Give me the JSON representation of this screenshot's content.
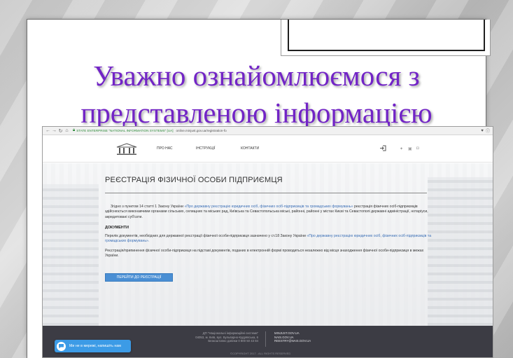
{
  "slide": {
    "title_line1": "Уважно ознайомлюємося з",
    "title_line2": "представленою інформацією"
  },
  "browser": {
    "secure_label": "STATE ENTERPRISE \"NATIONAL INFORMATION SYSTEMS\" [UA]",
    "url": "online.minjust.gov.ua/registration-fo"
  },
  "header": {
    "nav": [
      "ПРО НАС",
      "ІНСТРУКЦІЇ",
      "КОНТАКТИ"
    ]
  },
  "main": {
    "heading": "РЕЄСТРАЦІЯ ФІЗИЧНОЇ ОСОБИ ПІДПРИЄМЦЯ",
    "para1_text_a": "Згідно з пунктом 14 статті 1 Закону України ",
    "para1_link": "«Про державну реєстрацію юридичних осіб, фізичних осіб-підприємців та громадських формувань»",
    "para1_text_b": " реєстрація фізичних осіб-підприємців здійснюється виконавчими органами сільських, селищних та міських рад, Київська та Севастопольська міські, районні, районні у містах Києві та Севастополі державні адміністрації, нотаріуси, акредитовані суб'єкти.",
    "docs_heading": "ДОКУМЕНТИ",
    "para2_text_a": "Перелік документів, необхідних для державної реєстрації фізичної особи-підприємця зазначено у ст.18 Закону України ",
    "para2_link": "«Про державну реєстрацію юридичних осіб, фізичних осіб-підприємців та громадських формувань».",
    "para3": "Реєстрація/припинення фізичної особи-підприємця на підставі документів, поданих в електронній формі  проводиться незалежно від місця знаходження фізичної особи-підприємця в межах України.",
    "button": "ПЕРЕЙТИ ДО РЕЄСТРАЦІЇ"
  },
  "footer": {
    "address": [
      "ДП \"Національні інформаційні системи\"",
      "04053, м. Київ, вул. Бульварно-Кудрявська, 6",
      "Безкоштовно дзвінки 0 800 50 43 84"
    ],
    "links": [
      "MINJUST.GOV.UA",
      "NAIS.GOV.UA",
      "REESTRY@NAIS.GOV.UA"
    ],
    "copyright": "©COPYRIGHT 2017 - ALL RIGHTS RESERVED"
  },
  "chat": {
    "label": "Ми не в мережі, напишіть нам"
  },
  "colors": {
    "title": "#7224c6",
    "link": "#3b6fb6",
    "button": "#4a8fd4",
    "footer": "#3c3c44",
    "chat": "#3c9be6"
  },
  "icons": [
    "back-icon",
    "forward-icon",
    "reload-icon",
    "home-icon",
    "lock-icon",
    "bookmark-icon",
    "info-icon",
    "logo-icon",
    "login-icon",
    "twitter-icon",
    "facebook-icon",
    "instagram-icon",
    "chat-icon"
  ]
}
